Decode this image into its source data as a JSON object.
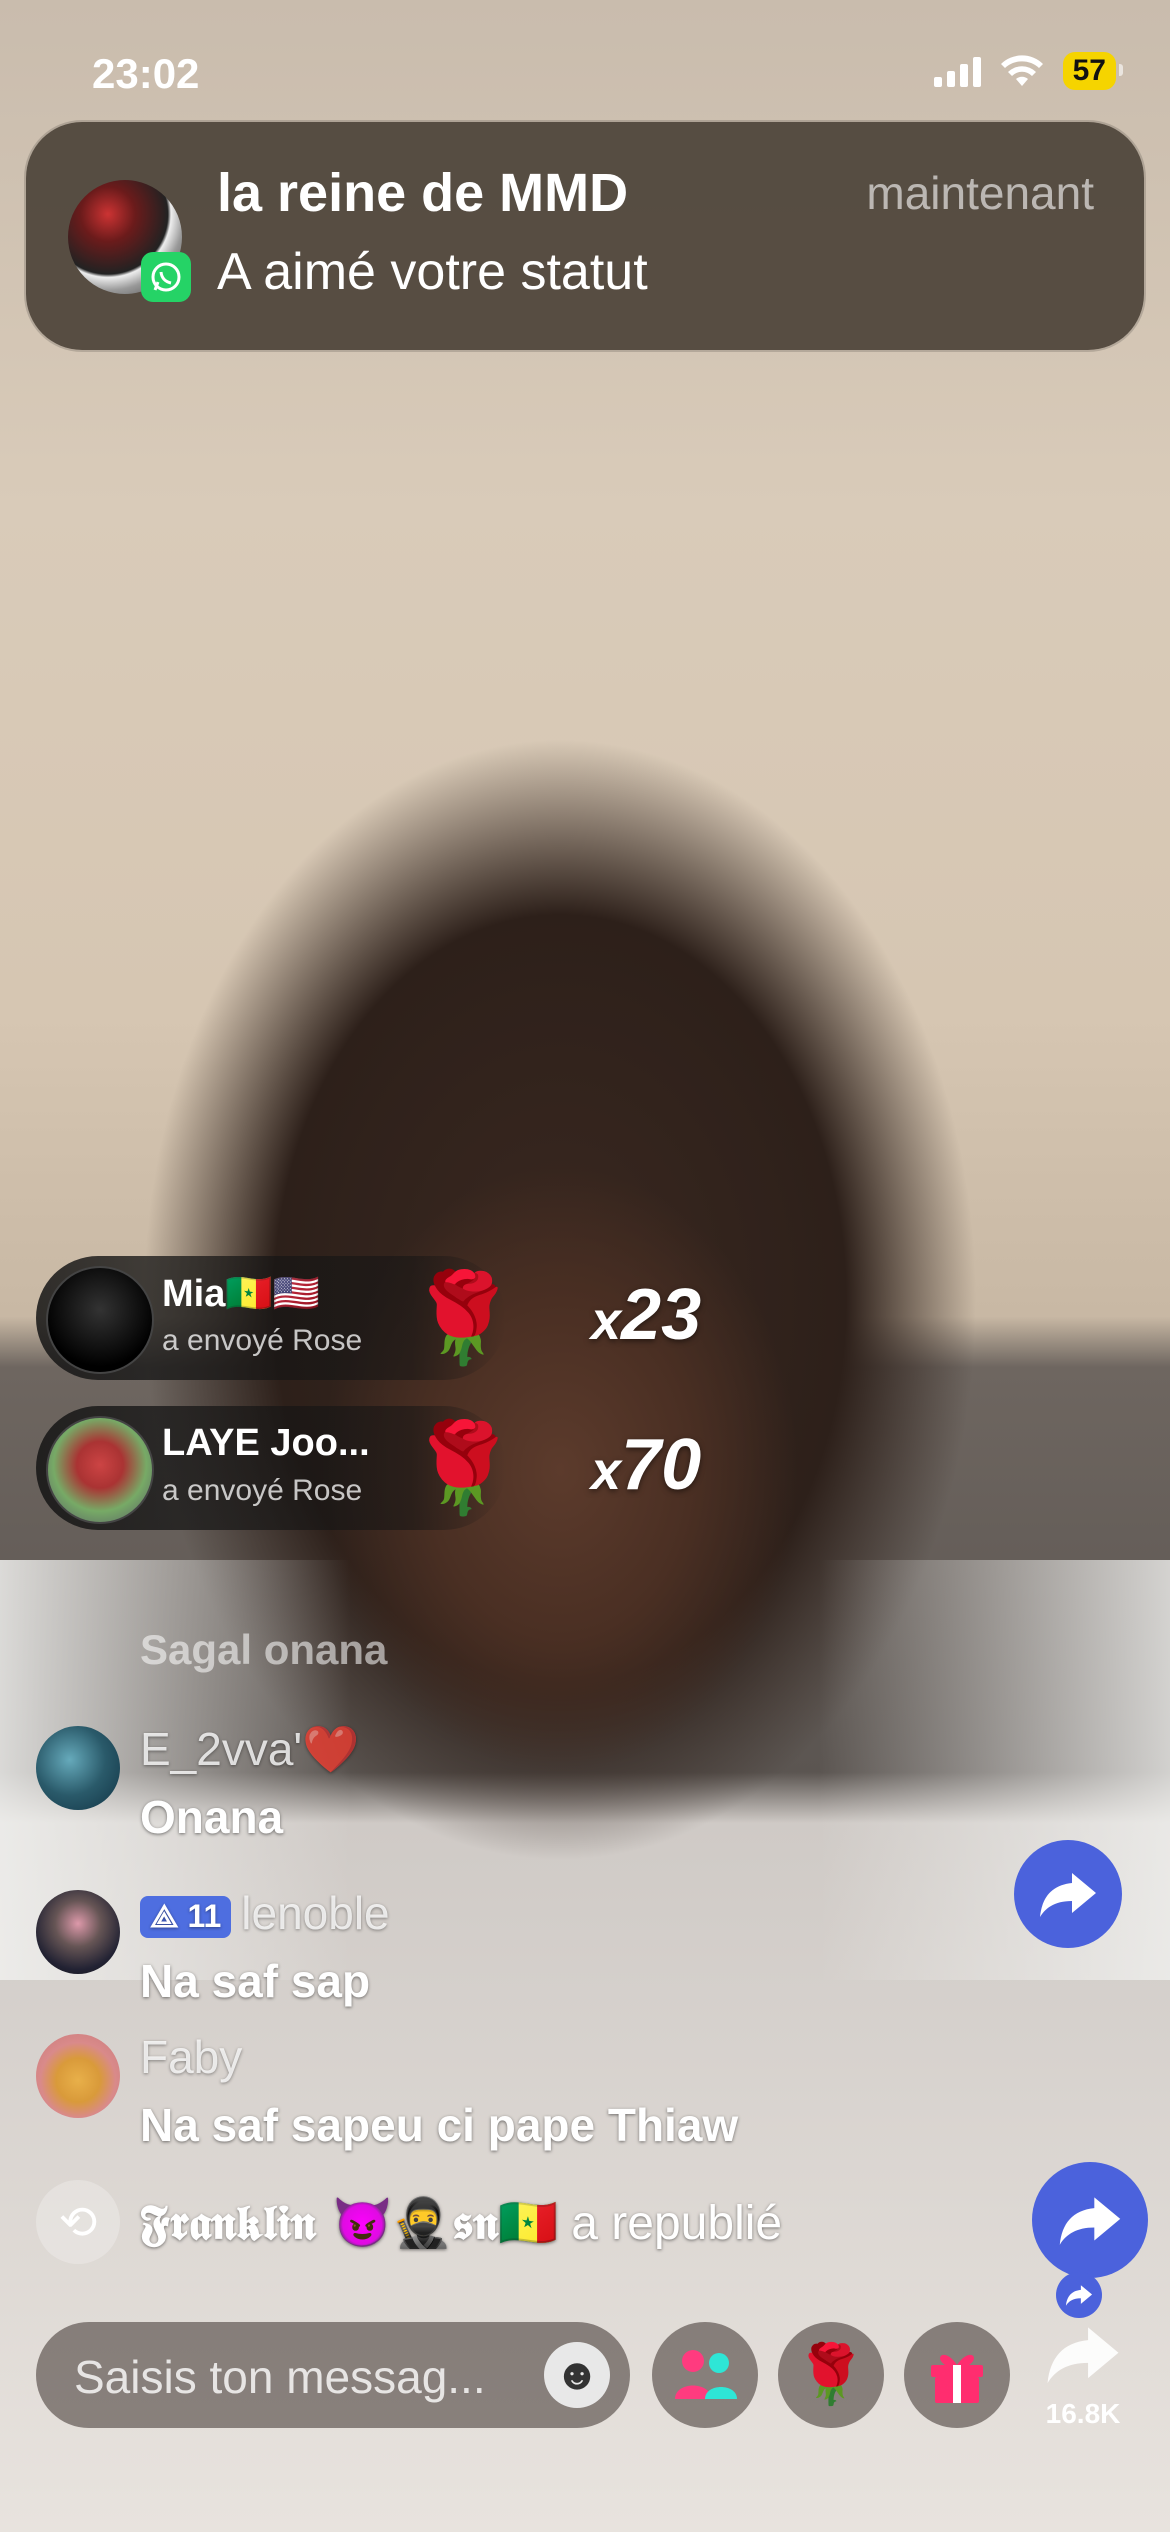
{
  "status_bar": {
    "time": "23:02",
    "battery": "57"
  },
  "notification": {
    "sender": "la reine de MMD",
    "time": "maintenant",
    "message": "A aimé votre statut",
    "app_icon": "whatsapp-icon"
  },
  "gifts": [
    {
      "name": "Mia🇸🇳🇺🇸",
      "action": "a envoyé  Rose",
      "gift_icon": "rose",
      "count_prefix": "x",
      "count": "23"
    },
    {
      "name": "LAYE Joo...",
      "action": "a envoyé  Rose",
      "gift_icon": "rose",
      "count_prefix": "x",
      "count": "70"
    }
  ],
  "chat": {
    "faded_name": "Sagal onana",
    "messages": [
      {
        "name": "E_2vva'❤️",
        "text": "Onana",
        "level": ""
      },
      {
        "name": "lenoble",
        "text": "Na saf sap",
        "level": "11"
      },
      {
        "name": "Faby",
        "text": "Na saf sapeu ci pape Thiaw",
        "level": ""
      }
    ],
    "repost": {
      "user": "𝕱𝖗𝖆𝖓𝖐𝖑𝖎𝖓 😈🥷𝖘𝖓🇸🇳",
      "action": "a republié"
    }
  },
  "bottom_bar": {
    "input_placeholder": "Saisis ton messag...",
    "share_count": "16.8K"
  },
  "colors": {
    "accent": "#4b62dc",
    "whatsapp": "#25d366",
    "battery": "#f5d400"
  }
}
